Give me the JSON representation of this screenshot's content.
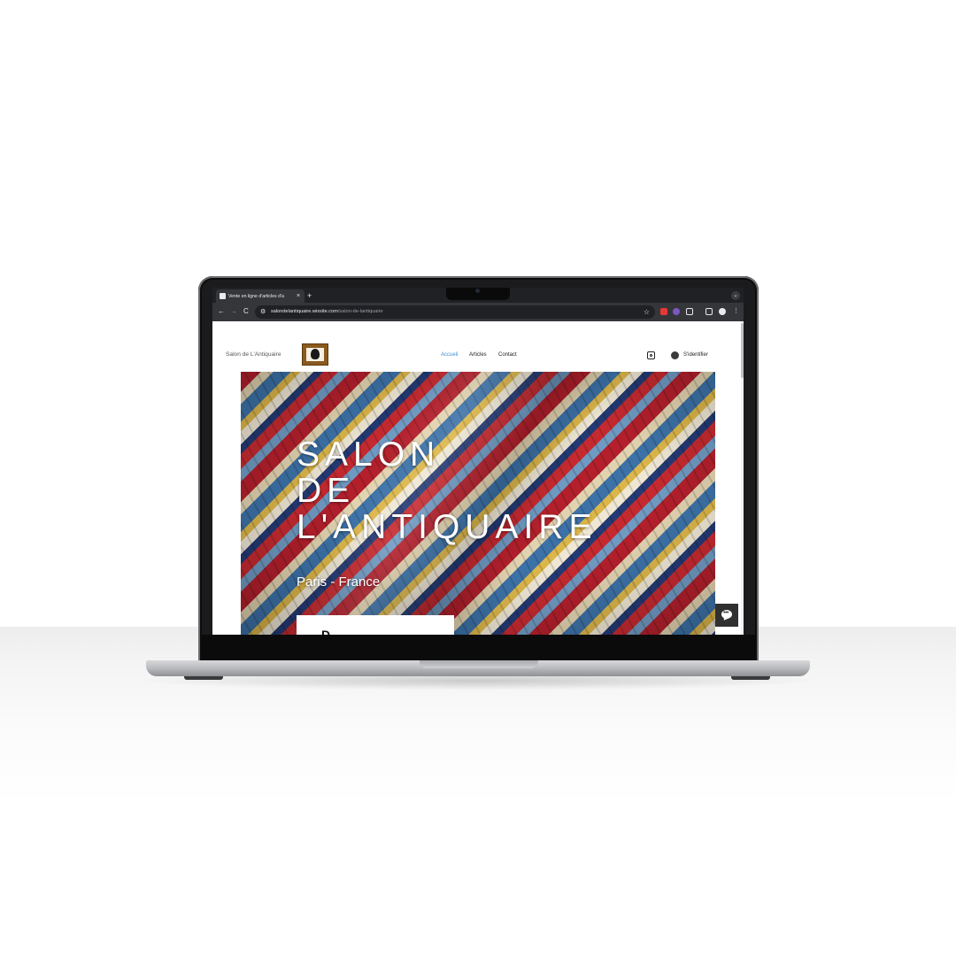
{
  "browser": {
    "tab_title": "Vente en ligne d'articles d'a",
    "tab_close": "×",
    "new_tab": "+",
    "tab_menu": "⌄",
    "back": "←",
    "forward": "→",
    "reload": "C",
    "url_host": "salondelantiquaire.wixsite.com",
    "url_path": "/salon-de-lantiquaire",
    "bookmark_icon": "☆",
    "extension_colors": [
      "#e53935",
      "#7e57c2"
    ],
    "menu_icon": "⋮"
  },
  "site": {
    "title": "Salon de L'Antiquaire",
    "nav": [
      {
        "label": "Accueil",
        "active": true
      },
      {
        "label": "Articles",
        "active": false
      },
      {
        "label": "Contact",
        "active": false
      }
    ],
    "login_label": "S'identifier",
    "accent": "#3f8fd6"
  },
  "hero": {
    "title_lines": [
      "SALON",
      "DE",
      "L'ANTIQUAIRE"
    ],
    "subtitle": "Paris - France",
    "card_text": "D"
  },
  "chat": {
    "dots": "•••"
  }
}
